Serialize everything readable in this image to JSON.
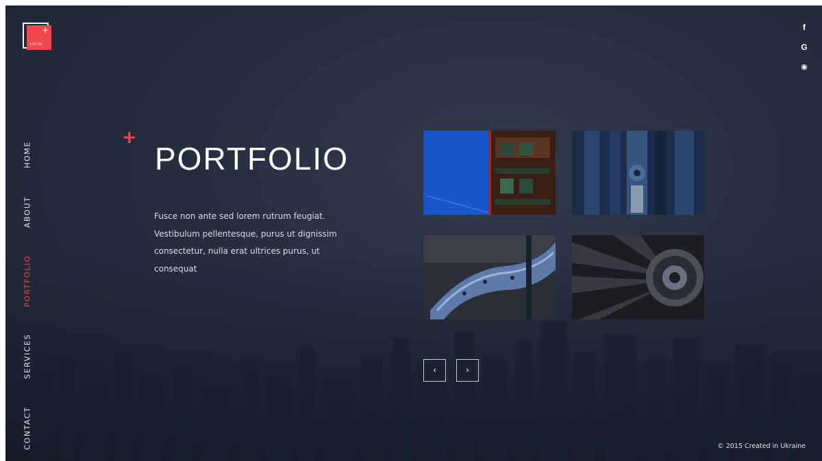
{
  "logo": {
    "text": "LUCID",
    "plus": "+",
    "accent_color": "#f0484e"
  },
  "social": [
    {
      "icon": "facebook-icon",
      "glyph": "f"
    },
    {
      "icon": "google-icon",
      "glyph": "G"
    },
    {
      "icon": "dribbble-icon",
      "glyph": "◉"
    }
  ],
  "nav": [
    {
      "label": "HOME",
      "active": false
    },
    {
      "label": "ABOUT",
      "active": false
    },
    {
      "label": "PORTFOLIO",
      "active": true
    },
    {
      "label": "SERVICES",
      "active": false
    },
    {
      "label": "CONTACT",
      "active": false
    }
  ],
  "hero": {
    "plus": "+",
    "title": "PORTFOLIO",
    "description": "Fusce non ante sed lorem rutrum feugiat. Vestibulum pellentesque, purus ut dignissim consectetur, nulla erat ultrices purus, ut consequat"
  },
  "gallery": {
    "prev_glyph": "‹",
    "next_glyph": "›"
  },
  "footer": {
    "text": "© 2015 Created in Ukraine"
  },
  "colors": {
    "accent": "#f0484e",
    "background": "#262e3e"
  }
}
